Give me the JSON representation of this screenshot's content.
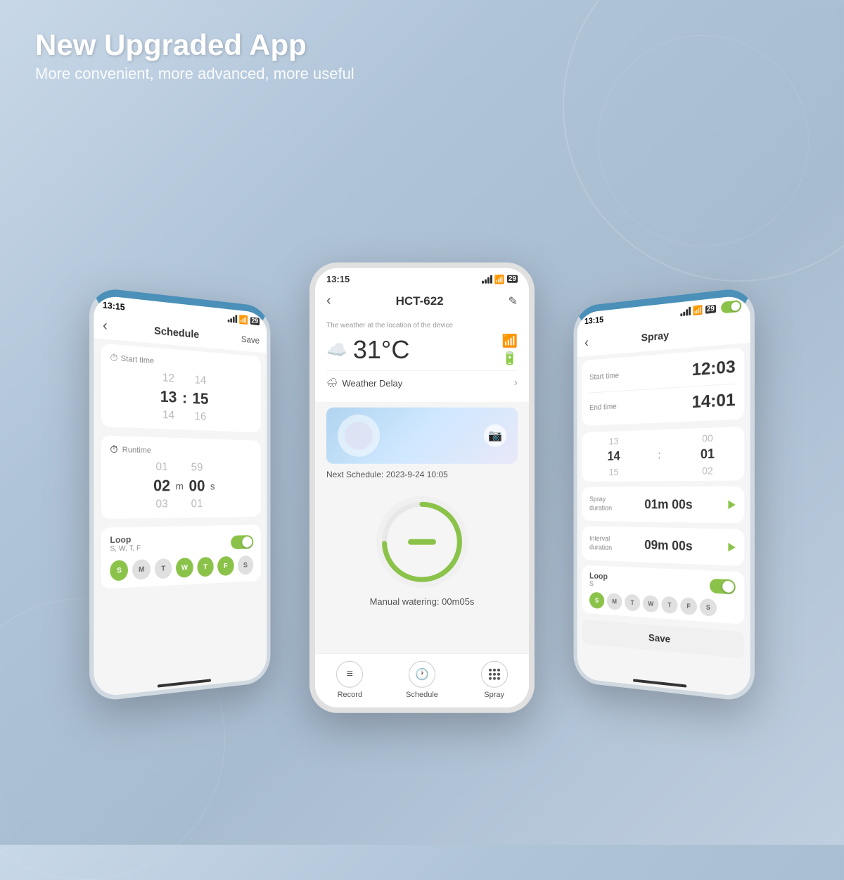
{
  "header": {
    "title": "New Upgraded App",
    "subtitle": "More convenient, more advanced, more useful"
  },
  "center_phone": {
    "status_bar": {
      "time": "13:15"
    },
    "nav": {
      "back": "‹",
      "title": "HCT-622",
      "edit_icon": "✎"
    },
    "weather": {
      "subtitle": "The weather at the location of the device",
      "temperature": "31°C",
      "delay_label": "Weather Delay"
    },
    "next_schedule": "Next Schedule:  2023-9-24 10:05",
    "manual_label": "Manual watering: 00m05s",
    "tabs": [
      {
        "icon": "📋",
        "label": "Record"
      },
      {
        "icon": "🕐",
        "label": "Schedule"
      },
      {
        "icon": "💧",
        "label": "Spray"
      }
    ]
  },
  "left_phone": {
    "status_bar": {
      "time": "13:15"
    },
    "header": {
      "back": "‹",
      "title": "Schedule",
      "save": "Save"
    },
    "start_time": {
      "label": "Start time",
      "hours_above": "12",
      "hours": "13",
      "hours_below": "14",
      "separator": ":",
      "minutes_above": "14",
      "minutes": "15",
      "minutes_below": "16"
    },
    "runtime": {
      "label": "Runtime",
      "hours_above": "01",
      "hours": "02",
      "hours_below": "03",
      "unit_h": "m",
      "seconds_above": "59",
      "seconds": "00",
      "seconds_below": "01",
      "unit_s": "s"
    },
    "loop": {
      "label": "Loop",
      "days_text": "S, W, T, F",
      "days": [
        "S",
        "M",
        "T",
        "W",
        "T",
        "F",
        "S"
      ],
      "active_days": [
        0,
        3,
        4,
        5
      ]
    }
  },
  "right_phone": {
    "status_bar": {
      "time": "13:15"
    },
    "header": {
      "back": "‹",
      "title": "Spray"
    },
    "start_time": {
      "label": "Start time",
      "value": "12:03"
    },
    "end_time": {
      "label": "End time",
      "value": "14:01"
    },
    "time_picker": {
      "rows_left": [
        "13",
        "14",
        "15"
      ],
      "rows_right": [
        "00",
        "01",
        "02"
      ],
      "selected_left": "14",
      "selected_right": "01"
    },
    "spray_duration": {
      "label": "Spray\nduration",
      "value": "01m 00s"
    },
    "interval_duration": {
      "label": "Interval\nduration",
      "value": "09m 00s"
    },
    "loop": {
      "label": "Loop",
      "days_text": "S",
      "days": [
        "S",
        "M",
        "T",
        "W",
        "T",
        "F",
        "S"
      ],
      "active_days": [
        0
      ]
    },
    "save_btn": "Save"
  }
}
